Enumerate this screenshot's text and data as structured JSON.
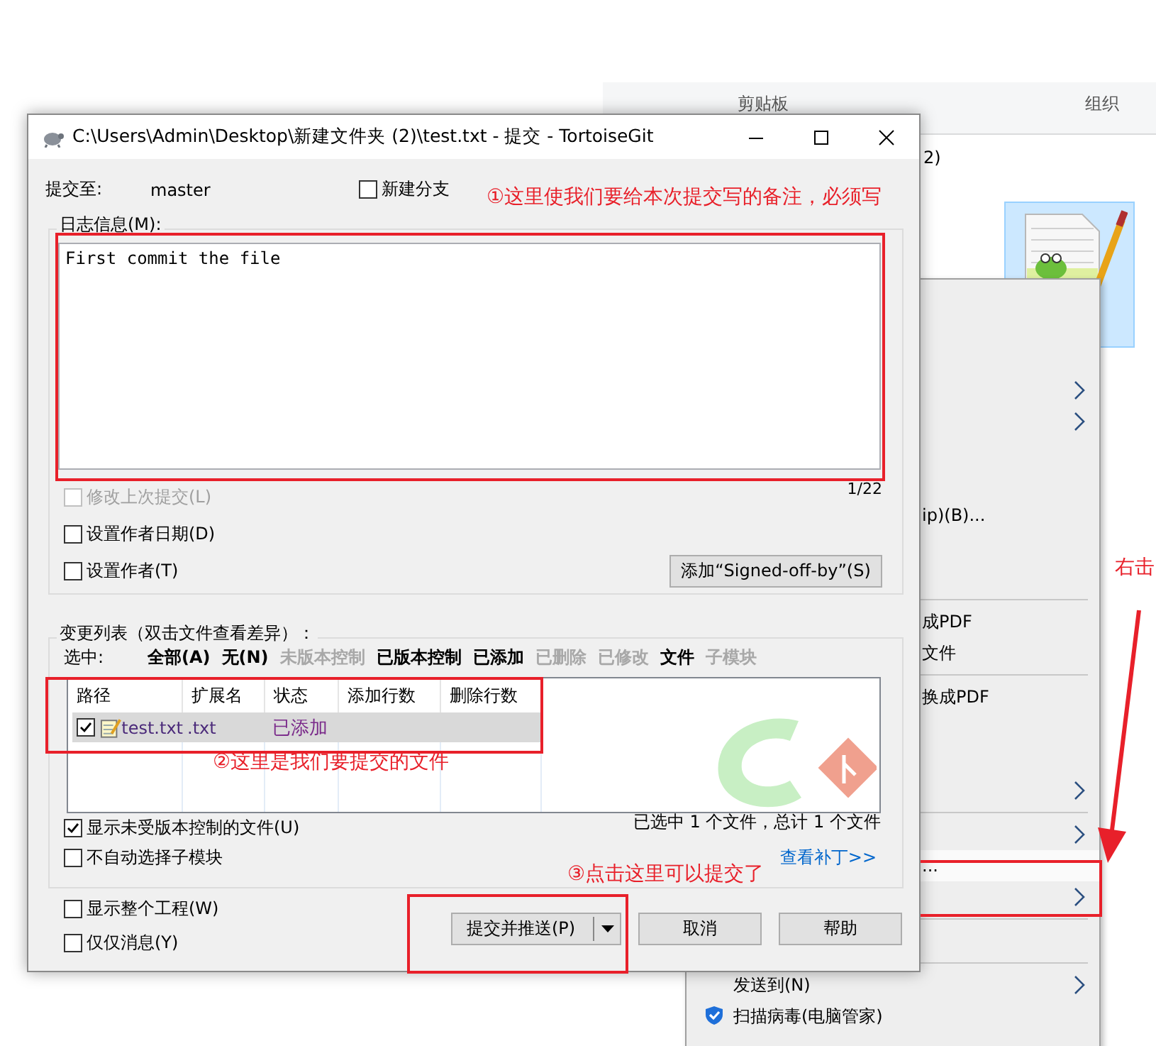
{
  "explorer": {
    "ribbon_groups": [
      "剪贴板",
      "组织"
    ],
    "address_fragment": "2)",
    "context_menu": [
      {
        "kind": "covered"
      },
      {
        "kind": "covered"
      },
      {
        "kind": "covered"
      },
      {
        "kind": "covered",
        "submenu": true
      },
      {
        "kind": "covered",
        "submenu": true
      },
      {
        "kind": "covered"
      },
      {
        "kind": "covered"
      },
      {
        "kind": "fragment",
        "label": "ip)(B)...",
        "selected": false
      },
      {
        "kind": "covered"
      },
      {
        "kind": "covered"
      },
      {
        "kind": "separator"
      },
      {
        "kind": "fragment",
        "label": "成PDF",
        "selected": false
      },
      {
        "kind": "fragment",
        "label": "文件",
        "selected": false
      },
      {
        "kind": "separator"
      },
      {
        "kind": "fragment",
        "label": "换成PDF",
        "selected": false
      },
      {
        "kind": "covered"
      },
      {
        "kind": "covered"
      },
      {
        "kind": "covered",
        "submenu": true
      },
      {
        "kind": "separator"
      },
      {
        "kind": "covered",
        "submenu": true
      },
      {
        "kind": "fragment",
        "label": "...",
        "selected": true
      },
      {
        "kind": "covered",
        "submenu": true
      },
      {
        "kind": "separator"
      },
      {
        "kind": "covered"
      },
      {
        "kind": "separator"
      },
      {
        "kind": "item",
        "label": "发送到(N)",
        "submenu": true,
        "selected": false
      },
      {
        "kind": "icon_item",
        "label": "扫描病毒(电脑管家)",
        "selected": false
      }
    ]
  },
  "window": {
    "title": "C:\\Users\\Admin\\Desktop\\新建文件夹 (2)\\test.txt - 提交 - TortoiseGit"
  },
  "commit_to": {
    "label": "提交至:",
    "branch": "master"
  },
  "new_branch": {
    "label": "新建分支",
    "checked": false
  },
  "message_group": {
    "title": "日志信息(M):",
    "message": "First commit the file",
    "counter": "1/22"
  },
  "options": [
    {
      "label": "修改上次提交(L)",
      "checked": false,
      "disabled": true
    },
    {
      "label": "设置作者日期(D)",
      "checked": false,
      "disabled": false
    },
    {
      "label": "设置作者(T)",
      "checked": false,
      "disabled": false
    }
  ],
  "signoff_button": "添加“Signed-off-by”(S)",
  "changes_group": {
    "title": "变更列表（双击文件查看差异）：",
    "select_label": "选中:",
    "filters": [
      {
        "label": "全部(A)",
        "enabled": true
      },
      {
        "label": "无(N)",
        "enabled": true
      },
      {
        "label": "未版本控制",
        "enabled": false
      },
      {
        "label": "已版本控制",
        "enabled": true
      },
      {
        "label": "已添加",
        "enabled": true
      },
      {
        "label": "已删除",
        "enabled": false
      },
      {
        "label": "已修改",
        "enabled": false
      },
      {
        "label": "文件",
        "enabled": true
      },
      {
        "label": "子模块",
        "enabled": false
      }
    ]
  },
  "file_table": {
    "columns": [
      "路径",
      "扩展名",
      "状态",
      "添加行数",
      "删除行数"
    ],
    "rows": [
      {
        "checked": true,
        "selected": true,
        "path": "test.txt",
        "extension": ".txt",
        "status": "已添加"
      }
    ]
  },
  "selection_summary": "已选中 1 个文件，总计 1 个文件",
  "list_options": [
    {
      "label": "显示未受版本控制的文件(U)",
      "checked": true
    },
    {
      "label": "不自动选择子模块",
      "checked": false
    }
  ],
  "patch_link": "查看补丁>>",
  "bottom_options": [
    {
      "label": "显示整个工程(W)",
      "checked": false
    },
    {
      "label": "仅仅消息(Y)",
      "checked": false
    }
  ],
  "buttons": [
    {
      "label": "提交并推送(P)",
      "kind": "split"
    },
    {
      "label": "取消",
      "kind": "normal"
    },
    {
      "label": "帮助",
      "kind": "normal"
    }
  ],
  "annotations": [
    "①这里使我们要给本次提交写的备注，必须写",
    "②这里是我们要提交的文件",
    "③点击这里可以提交了",
    "右击"
  ]
}
